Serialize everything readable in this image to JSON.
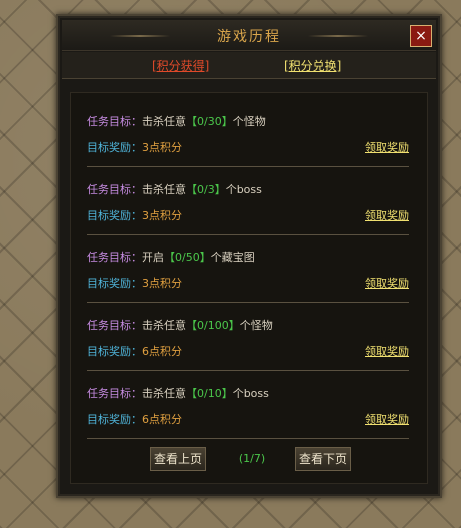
{
  "window": {
    "title": "游戏历程",
    "close_icon": "×"
  },
  "tabs": [
    {
      "label": "[积分获得]",
      "active": true
    },
    {
      "label": "[积分兑换]",
      "active": false
    }
  ],
  "labels": {
    "task": "任务目标：",
    "reward": "目标奖励：",
    "claim": "领取奖励",
    "bracket_open": "【",
    "bracket_close": "】"
  },
  "quests": [
    {
      "action": "击杀任意",
      "progress": "0/30",
      "target": "个怪物",
      "reward": "3点积分"
    },
    {
      "action": "击杀任意",
      "progress": "0/3",
      "target": "个boss",
      "reward": "3点积分"
    },
    {
      "action": "开启",
      "progress": "0/50",
      "target": "个藏宝图",
      "reward": "3点积分"
    },
    {
      "action": "击杀任意",
      "progress": "0/100",
      "target": "个怪物",
      "reward": "6点积分"
    },
    {
      "action": "击杀任意",
      "progress": "0/10",
      "target": "个boss",
      "reward": "6点积分"
    }
  ],
  "pagination": {
    "prev_label": "查看上页",
    "next_label": "查看下页",
    "indicator": "(1/7)"
  },
  "colors": {
    "title": "#d9a54b",
    "active_tab": "#e04a2a",
    "link": "#f0e070",
    "task_label": "#c58be0",
    "reward_label": "#4fb3d8",
    "progress": "#4bc64b",
    "reward_value": "#e0a040"
  }
}
